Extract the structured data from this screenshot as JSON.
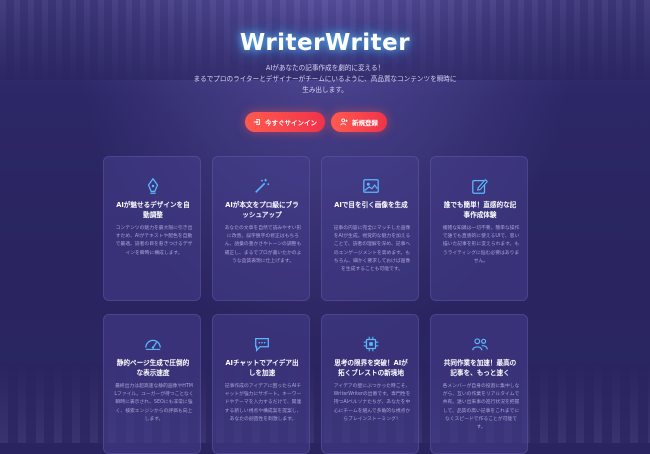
{
  "app": {
    "title": "WriterWriter",
    "subtitle_lines": [
      "AIがあなたの記事作成を劇的に変える！",
      "まるでプロのライターとデザイナーがチームにいるように、高品質なコンテンツを瞬時に",
      "生み出します。"
    ]
  },
  "buttons": {
    "login": "今すぐサインイン",
    "register": "新規登録"
  },
  "colors": {
    "accent": "#f0334b",
    "icon": "#5ab8ff",
    "background": "#2a2560"
  },
  "cards": [
    {
      "icon": "pen-nib-icon",
      "title": "AIが魅せるデザインを自動調整",
      "desc": "コンテンツの魅力を最大限に引き出すため、AIがテキストや配色を自動で最適。読者の目を惹きつけるデザインを瞬時に構成します。"
    },
    {
      "icon": "magic-wand-icon",
      "title": "AIが本文をプロ級にブラッシュアップ",
      "desc": "あなたの文章を自然で読みやすい形に改善。誤字脱字の修正はもちろん、語彙の豊かさやトーンの調整も補正し、まるでプロが書いたかのような品質表現に仕上げます。"
    },
    {
      "icon": "image-icon",
      "title": "AIで目を引く画像を生成",
      "desc": "記事の内容に完全にマッチした画像をAIが生成。視覚的な魅力を加えることで、読者の理解を深め、記事へのエンゲージメントを高めます。もちろん、細かく要求しておけば画像を生成することも可能です。"
    },
    {
      "icon": "edit-square-icon",
      "title": "誰でも簡単！直感的な記事作成体験",
      "desc": "複雑な知識は一切不要。簡単な操作で誰でも直感的に使えるUIで、思い描いた記事を形に変えられます。もうライティングに悩む必要はありません。"
    },
    {
      "icon": "speedometer-icon",
      "title": "静的ページ生成で圧倒的な表示速度",
      "desc": "最終出力は超高速な静的画像やHTMLファイル。ユーガーが待つことなく瞬時に表示され、SEOにも非常に強く、検索エンジンからの評価も向上します。"
    },
    {
      "icon": "chat-bubble-icon",
      "title": "AIチャットでアイデア出しを加速",
      "desc": "記事作成のアイデアに困ったらAIチャットが強力にサポート。キーワードやテーマを入力するだけで、関連する新しい視点や構成案を提案し、あなたの創造性を刺激します。"
    },
    {
      "icon": "cpu-chip-icon",
      "title": "思考の限界を突破！AIが拓くブレストの新境地",
      "desc": "アイデアの壁にぶつかった時こそ、WriterWriterの出番です。専門性を持つAIペルソナたちが、あなたを中心にチームを組んで多角的な視点からブレインストーミング！"
    },
    {
      "icon": "team-users-icon",
      "title": "共同作業を加速！最高の記事を、もっと速く",
      "desc": "各メンバーが自身の役割に集中しながら、互いの作業をリアルタイムで共有。遠い出来事の進行状況を把握して、品質の高い記事をこれまでになくスピードで作ることが可能です。"
    }
  ]
}
